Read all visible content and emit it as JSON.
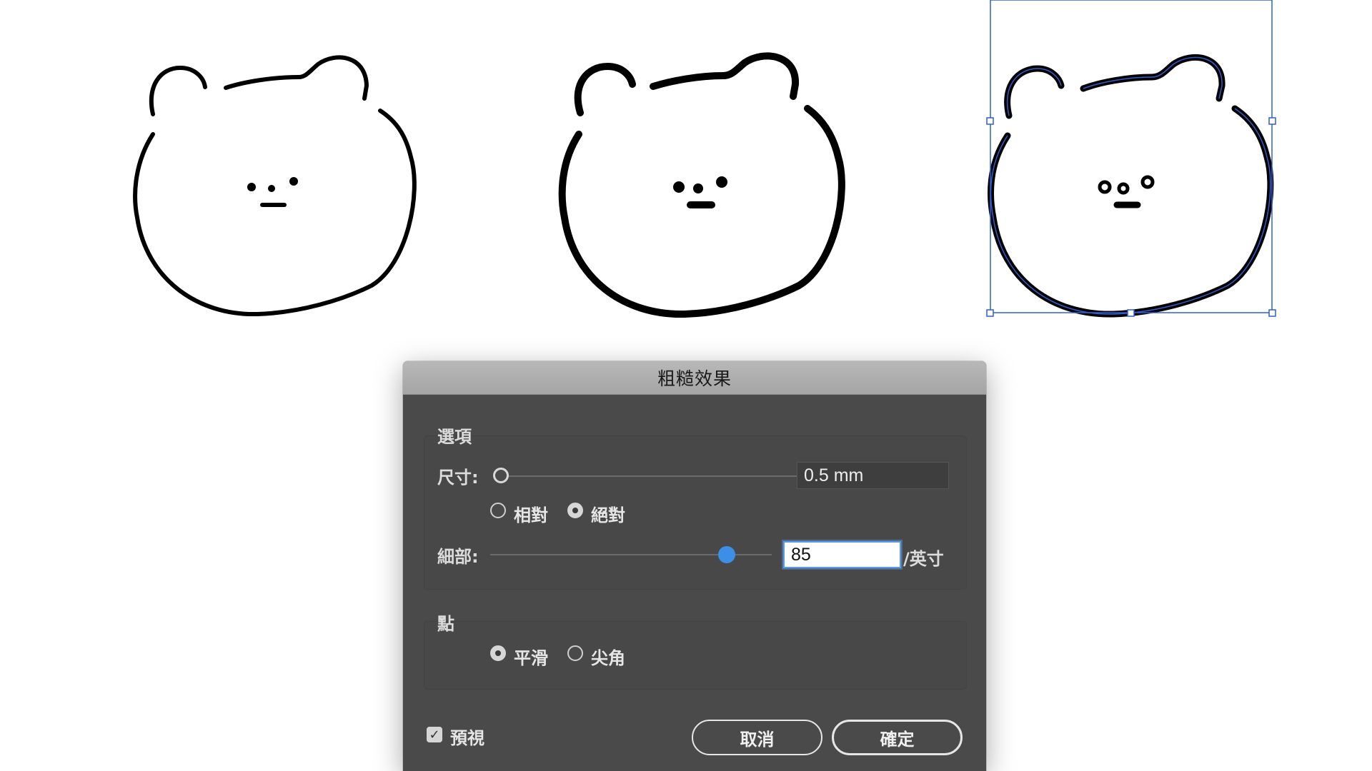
{
  "dialog": {
    "title": "粗糙效果",
    "options": {
      "group_label": "選項",
      "size_label": "尺寸:",
      "size_value": "0.5 mm",
      "size_slider_fraction": 0.0,
      "relative_label": "相對",
      "absolute_label": "絕對",
      "selected_mode": "absolute",
      "detail_label": "細部:",
      "detail_value": "85",
      "detail_slider_fraction": 0.85,
      "detail_unit": "/英寸"
    },
    "points": {
      "group_label": "點",
      "smooth_label": "平滑",
      "corner_label": "尖角",
      "selected": "smooth"
    },
    "preview_label": "預視",
    "preview_checked": true,
    "cancel_label": "取消",
    "ok_label": "確定"
  },
  "colors": {
    "selection_blue": "#2f5fd0",
    "slider_blue": "#3d8ee6"
  }
}
